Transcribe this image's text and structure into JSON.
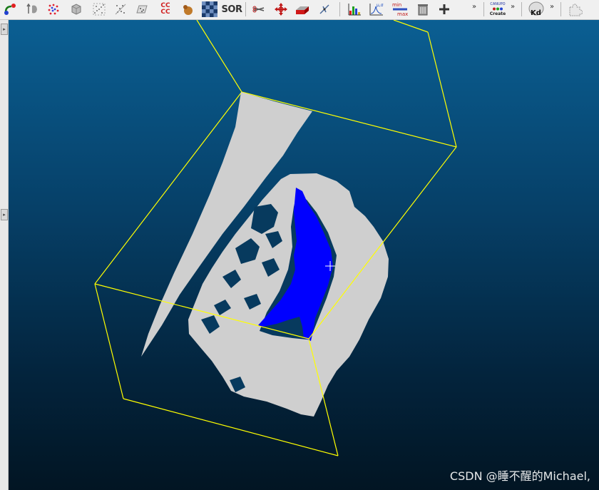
{
  "toolbar": {
    "sor_label": "SOR",
    "cccc_label": "CC\nCC",
    "minmax_min": "min",
    "minmax_max": "max",
    "mu_sigma": "μ,σ",
    "canupo_top": "CANUPO",
    "canupo_create": "Create",
    "kd_label": "Kd",
    "overflow": "»"
  },
  "watermark": "CSDN @睡不醒的Michael,",
  "colors": {
    "cloud": "#cfcfcf",
    "selection": "#0000ff",
    "bbox": "#ffff00",
    "bg_top": "#0b5f93",
    "bg_bottom": "#021523"
  },
  "icons": [
    "merge-icon",
    "point-pick-icon",
    "sample-icon",
    "subsample-icon",
    "noise-icon",
    "cube-icon",
    "scatter-icon",
    "fit-plane-icon",
    "cccc-icon",
    "fruit-icon",
    "checker-icon",
    "sor-icon",
    "scissors-icon",
    "translate-icon",
    "segment-box-icon",
    "normals-icon",
    "histogram-icon",
    "stats-icon",
    "minmax-icon",
    "trash-icon",
    "plus-icon",
    "canupo-icon",
    "kd-icon",
    "plugin-icon"
  ]
}
